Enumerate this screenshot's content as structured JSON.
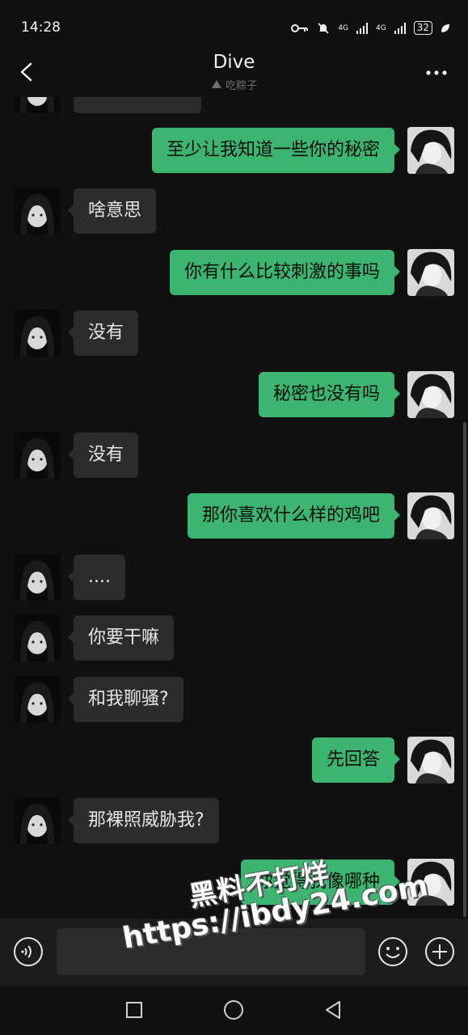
{
  "status_bar": {
    "time": "14:28",
    "battery": "32",
    "network_a": "4G",
    "network_b": "4G"
  },
  "header": {
    "title": "Dive",
    "subtitle": "吃粽子"
  },
  "messages": [
    {
      "side": "right",
      "text": "至少让我知道一些你的秘密"
    },
    {
      "side": "left",
      "text": "啥意思"
    },
    {
      "side": "right",
      "text": "你有什么比较刺激的事吗"
    },
    {
      "side": "left",
      "text": "没有"
    },
    {
      "side": "right",
      "text": "秘密也没有吗"
    },
    {
      "side": "left",
      "text": "没有"
    },
    {
      "side": "right",
      "text": "那你喜欢什么样的鸡吧"
    },
    {
      "side": "left",
      "text": "...."
    },
    {
      "side": "left",
      "text": "你要干嘛"
    },
    {
      "side": "left",
      "text": "和我聊骚?"
    },
    {
      "side": "right",
      "text": "先回答"
    },
    {
      "side": "left",
      "text": "那裸照威胁我?"
    },
    {
      "side": "right",
      "text": "你觉得我像哪种"
    }
  ],
  "watermark": {
    "line1": "黑料不打烊",
    "line2": "https://ibdy24.com"
  },
  "colors": {
    "sent_bubble": "#3cb571",
    "received_bubble": "#2c2c2c",
    "background": "#111111"
  },
  "icons": {
    "back": "chevron-left-icon",
    "more": "more-dots-icon",
    "voice": "voice-icon",
    "emoji": "emoji-icon",
    "plus": "plus-icon"
  }
}
